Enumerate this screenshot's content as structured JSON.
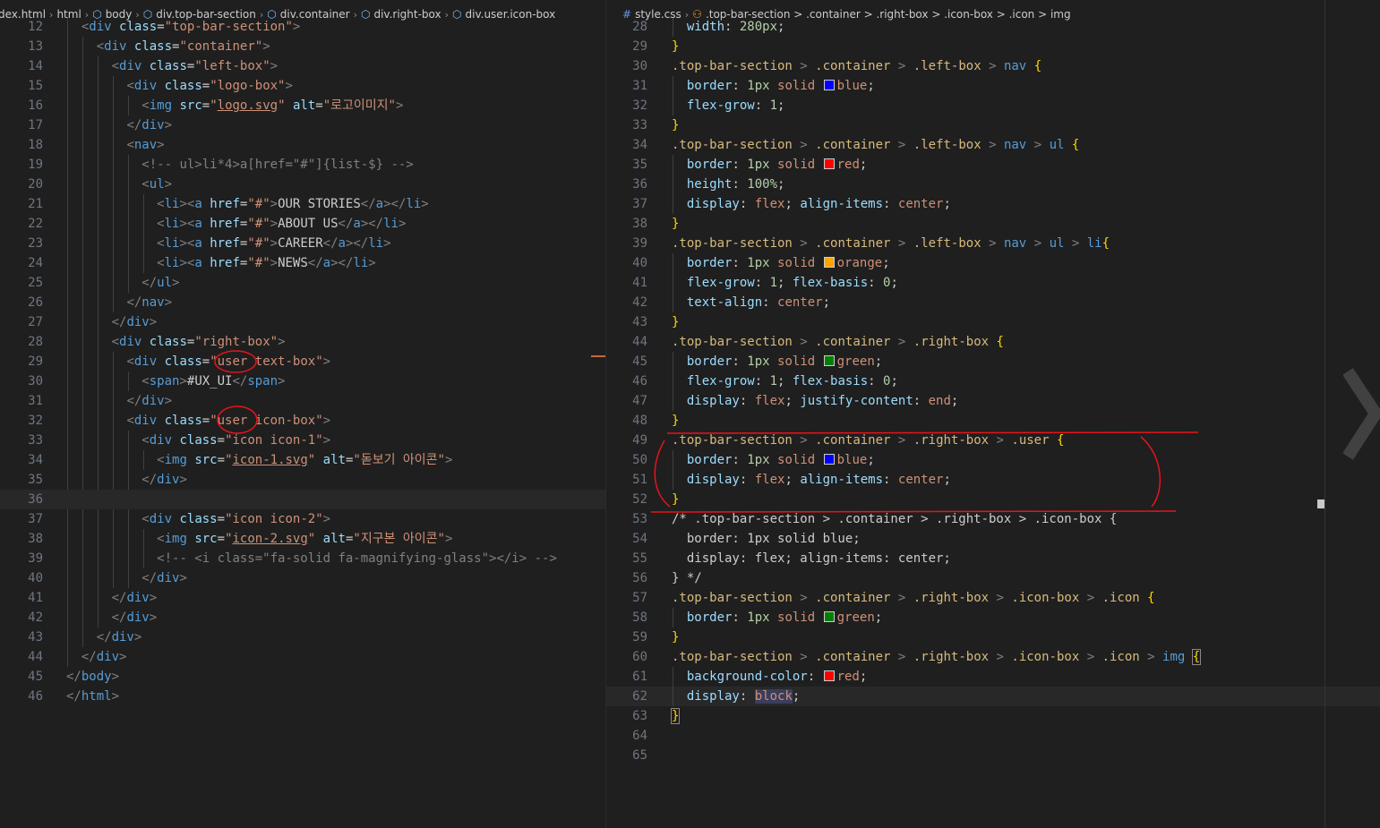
{
  "left_editor": {
    "breadcrumb": [
      "dex.html",
      "html",
      "body",
      "div.top-bar-section",
      "div.container",
      "div.right-box",
      "div.user.icon-box"
    ],
    "lines": [
      {
        "n": "12",
        "html": "  <span class='p'>&lt;</span><span class='t'>div</span> <span class='a'>class</span>=<span class='s'>\"top-bar-section\"</span><span class='p'>&gt;</span>"
      },
      {
        "n": "13",
        "html": "    <span class='p'>&lt;</span><span class='t'>div</span> <span class='a'>class</span>=<span class='s'>\"container\"</span><span class='p'>&gt;</span>"
      },
      {
        "n": "14",
        "html": "      <span class='p'>&lt;</span><span class='t'>div</span> <span class='a'>class</span>=<span class='s'>\"left-box\"</span><span class='p'>&gt;</span>"
      },
      {
        "n": "15",
        "html": "        <span class='p'>&lt;</span><span class='t'>div</span> <span class='a'>class</span>=<span class='s'>\"logo-box\"</span><span class='p'>&gt;</span>"
      },
      {
        "n": "16",
        "html": "          <span class='p'>&lt;</span><span class='t'>img</span> <span class='a'>src</span>=<span class='s'>\"<span class='ul'>logo.svg</span>\"</span> <span class='a'>alt</span>=<span class='s'>\"로고이미지\"</span><span class='p'>&gt;</span>"
      },
      {
        "n": "17",
        "html": "        <span class='p'>&lt;/</span><span class='t'>div</span><span class='p'>&gt;</span>"
      },
      {
        "n": "18",
        "html": "        <span class='p'>&lt;</span><span class='t'>nav</span><span class='p'>&gt;</span>"
      },
      {
        "n": "19",
        "html": "          <span class='p'>&lt;!-- ul&gt;li*4&gt;a[href=\"#\"]{list-$} --&gt;</span>"
      },
      {
        "n": "20",
        "html": "          <span class='p'>&lt;</span><span class='t'>ul</span><span class='p'>&gt;</span>"
      },
      {
        "n": "21",
        "html": "            <span class='p'>&lt;</span><span class='t'>li</span><span class='p'>&gt;&lt;</span><span class='t'>a</span> <span class='a'>href</span>=<span class='s'>\"#\"</span><span class='p'>&gt;</span><span class='plain'>OUR STORIES</span><span class='p'>&lt;/</span><span class='t'>a</span><span class='p'>&gt;&lt;/</span><span class='t'>li</span><span class='p'>&gt;</span>"
      },
      {
        "n": "22",
        "html": "            <span class='p'>&lt;</span><span class='t'>li</span><span class='p'>&gt;&lt;</span><span class='t'>a</span> <span class='a'>href</span>=<span class='s'>\"#\"</span><span class='p'>&gt;</span><span class='plain'>ABOUT US</span><span class='p'>&lt;/</span><span class='t'>a</span><span class='p'>&gt;&lt;/</span><span class='t'>li</span><span class='p'>&gt;</span>"
      },
      {
        "n": "23",
        "html": "            <span class='p'>&lt;</span><span class='t'>li</span><span class='p'>&gt;&lt;</span><span class='t'>a</span> <span class='a'>href</span>=<span class='s'>\"#\"</span><span class='p'>&gt;</span><span class='plain'>CAREER</span><span class='p'>&lt;/</span><span class='t'>a</span><span class='p'>&gt;&lt;/</span><span class='t'>li</span><span class='p'>&gt;</span>"
      },
      {
        "n": "24",
        "html": "            <span class='p'>&lt;</span><span class='t'>li</span><span class='p'>&gt;&lt;</span><span class='t'>a</span> <span class='a'>href</span>=<span class='s'>\"#\"</span><span class='p'>&gt;</span><span class='plain'>NEWS</span><span class='p'>&lt;/</span><span class='t'>a</span><span class='p'>&gt;&lt;/</span><span class='t'>li</span><span class='p'>&gt;</span>"
      },
      {
        "n": "25",
        "html": "          <span class='p'>&lt;/</span><span class='t'>ul</span><span class='p'>&gt;</span>"
      },
      {
        "n": "26",
        "html": "        <span class='p'>&lt;/</span><span class='t'>nav</span><span class='p'>&gt;</span>"
      },
      {
        "n": "27",
        "html": "      <span class='p'>&lt;/</span><span class='t'>div</span><span class='p'>&gt;</span>"
      },
      {
        "n": "28",
        "html": "      <span class='p'>&lt;</span><span class='t'>div</span> <span class='a'>class</span>=<span class='s'>\"right-box\"</span><span class='p'>&gt;</span>"
      },
      {
        "n": "29",
        "html": "        <span class='p'>&lt;</span><span class='t'>div</span> <span class='a'>class</span>=<span class='s'>\"user text-box\"</span><span class='p'>&gt;</span>"
      },
      {
        "n": "30",
        "html": "          <span class='p'>&lt;</span><span class='t'>span</span><span class='p'>&gt;</span><span class='plain'>#UX_UI</span><span class='p'>&lt;/</span><span class='t'>span</span><span class='p'>&gt;</span>"
      },
      {
        "n": "31",
        "html": "        <span class='p'>&lt;/</span><span class='t'>div</span><span class='p'>&gt;</span>"
      },
      {
        "n": "32",
        "html": "        <span class='p'>&lt;</span><span class='t'>div</span> <span class='a'>class</span>=<span class='s'>\"user icon-box\"</span><span class='p'>&gt;</span>"
      },
      {
        "n": "33",
        "html": "          <span class='p'>&lt;</span><span class='t'>div</span> <span class='a'>class</span>=<span class='s'>\"icon icon-1\"</span><span class='p'>&gt;</span>"
      },
      {
        "n": "34",
        "html": "            <span class='p'>&lt;</span><span class='t'>img</span> <span class='a'>src</span>=<span class='s'>\"<span class='ul'>icon-1.svg</span>\"</span> <span class='a'>alt</span>=<span class='s'>\"돋보기 아이콘\"</span><span class='p'>&gt;</span>"
      },
      {
        "n": "35",
        "html": "          <span class='p'>&lt;/</span><span class='t'>div</span><span class='p'>&gt;</span>"
      },
      {
        "n": "36",
        "html": ""
      },
      {
        "n": "37",
        "html": "          <span class='p'>&lt;</span><span class='t'>div</span> <span class='a'>class</span>=<span class='s'>\"icon icon-2\"</span><span class='p'>&gt;</span>"
      },
      {
        "n": "38",
        "html": "            <span class='p'>&lt;</span><span class='t'>img</span> <span class='a'>src</span>=<span class='s'>\"<span class='ul'>icon-2.svg</span>\"</span> <span class='a'>alt</span>=<span class='s'>\"지구본 아이콘\"</span><span class='p'>&gt;</span>"
      },
      {
        "n": "39",
        "html": "            <span class='p'>&lt;!-- &lt;i class=\"fa-solid fa-magnifying-glass\"&gt;&lt;/i&gt; --&gt;</span>"
      },
      {
        "n": "40",
        "html": "          <span class='p'>&lt;/</span><span class='t'>div</span><span class='p'>&gt;</span>"
      },
      {
        "n": "41",
        "html": "      <span class='p'>&lt;/</span><span class='t'>div</span><span class='p'>&gt;</span>"
      },
      {
        "n": "42",
        "html": "      <span class='p'>&lt;/</span><span class='t'>div</span><span class='p'>&gt;</span>"
      },
      {
        "n": "43",
        "html": "    <span class='p'>&lt;/</span><span class='t'>div</span><span class='p'>&gt;</span>"
      },
      {
        "n": "44",
        "html": "  <span class='p'>&lt;/</span><span class='t'>div</span><span class='p'>&gt;</span>"
      },
      {
        "n": "45",
        "html": "<span class='p'>&lt;/</span><span class='t'>body</span><span class='p'>&gt;</span>"
      },
      {
        "n": "46",
        "html": "<span class='p'>&lt;/</span><span class='t'>html</span><span class='p'>&gt;</span>"
      }
    ],
    "current_line": "36"
  },
  "right_editor": {
    "breadcrumb": [
      "style.css",
      ".top-bar-section > .container > .right-box > .icon-box > .icon > img"
    ],
    "lines": [
      {
        "n": "28",
        "html": "  <span class='pr'>width</span>: <span class='n'>280px</span>;"
      },
      {
        "n": "29",
        "html": "<span class='y'>}</span>"
      },
      {
        "n": "30",
        "html": "<span class='sel'>.top-bar-section</span> <span class='p'>&gt;</span> <span class='sel'>.container</span> <span class='p'>&gt;</span> <span class='sel'>.left-box</span> <span class='p'>&gt;</span> <span class='t'>nav</span> <span class='y'>{</span>"
      },
      {
        "n": "31",
        "html": "  <span class='pr'>border</span>: <span class='n'>1px</span> <span class='v'>solid</span> <span class='sw' style='background:#0000ff'></span><span class='v'>blue</span>;"
      },
      {
        "n": "32",
        "html": "  <span class='pr'>flex-grow</span>: <span class='n'>1</span>;"
      },
      {
        "n": "33",
        "html": "<span class='y'>}</span>"
      },
      {
        "n": "34",
        "html": "<span class='sel'>.top-bar-section</span> <span class='p'>&gt;</span> <span class='sel'>.container</span> <span class='p'>&gt;</span> <span class='sel'>.left-box</span> <span class='p'>&gt;</span> <span class='t'>nav</span> <span class='p'>&gt;</span> <span class='t'>ul</span> <span class='y'>{</span>"
      },
      {
        "n": "35",
        "html": "  <span class='pr'>border</span>: <span class='n'>1px</span> <span class='v'>solid</span> <span class='sw' style='background:#ff0000'></span><span class='v'>red</span>;"
      },
      {
        "n": "36",
        "html": "  <span class='pr'>height</span>: <span class='n'>100%</span>;"
      },
      {
        "n": "37",
        "html": "  <span class='pr'>display</span>: <span class='v'>flex</span>; <span class='pr'>align-items</span>: <span class='v'>center</span>;"
      },
      {
        "n": "38",
        "html": "<span class='y'>}</span>"
      },
      {
        "n": "39",
        "html": "<span class='sel'>.top-bar-section</span> <span class='p'>&gt;</span> <span class='sel'>.container</span> <span class='p'>&gt;</span> <span class='sel'>.left-box</span> <span class='p'>&gt;</span> <span class='t'>nav</span> <span class='p'>&gt;</span> <span class='t'>ul</span> <span class='p'>&gt;</span> <span class='t'>li</span><span class='y'>{</span>"
      },
      {
        "n": "40",
        "html": "  <span class='pr'>border</span>: <span class='n'>1px</span> <span class='v'>solid</span> <span class='sw' style='background:#ffa500'></span><span class='v'>orange</span>;"
      },
      {
        "n": "41",
        "html": "  <span class='pr'>flex-grow</span>: <span class='n'>1</span>; <span class='pr'>flex-basis</span>: <span class='n'>0</span>;"
      },
      {
        "n": "42",
        "html": "  <span class='pr'>text-align</span>: <span class='v'>center</span>;"
      },
      {
        "n": "43",
        "html": "<span class='y'>}</span>"
      },
      {
        "n": "44",
        "html": "<span class='sel'>.top-bar-section</span> <span class='p'>&gt;</span> <span class='sel'>.container</span> <span class='p'>&gt;</span> <span class='sel'>.right-box</span> <span class='y'>{</span>"
      },
      {
        "n": "45",
        "html": "  <span class='pr'>border</span>: <span class='n'>1px</span> <span class='v'>solid</span> <span class='sw' style='background:#008000'></span><span class='v'>green</span>;"
      },
      {
        "n": "46",
        "html": "  <span class='pr'>flex-grow</span>: <span class='n'>1</span>; <span class='pr'>flex-basis</span>: <span class='n'>0</span>;"
      },
      {
        "n": "47",
        "html": "  <span class='pr'>display</span>: <span class='v'>flex</span>; <span class='pr'>justify-content</span>: <span class='v'>end</span>;"
      },
      {
        "n": "48",
        "html": "<span class='y'>}</span>"
      },
      {
        "n": "49",
        "html": "<span class='sel'>.top-bar-section</span> <span class='p'>&gt;</span> <span class='sel'>.container</span> <span class='p'>&gt;</span> <span class='sel'>.right-box</span> <span class='p'>&gt;</span> <span class='sel'>.user</span> <span class='y'>{</span>"
      },
      {
        "n": "50",
        "html": "  <span class='pr'>border</span>: <span class='n'>1px</span> <span class='v'>solid</span> <span class='sw' style='background:#0000ff'></span><span class='v'>blue</span>;"
      },
      {
        "n": "51",
        "html": "  <span class='pr'>display</span>: <span class='v'>flex</span>; <span class='pr'>align-items</span>: <span class='v'>center</span>;"
      },
      {
        "n": "52",
        "html": "<span class='y'>}</span>"
      },
      {
        "n": "53",
        "html": "<span class='plain'>/* .top-bar-section &gt; .container &gt; .right-box &gt; .icon-box {</span>"
      },
      {
        "n": "54",
        "html": "<span class='plain'>  border: 1px solid blue;</span>"
      },
      {
        "n": "55",
        "html": "<span class='plain'>  display: flex; align-items: center;</span>"
      },
      {
        "n": "56",
        "html": "<span class='plain'>} */</span>"
      },
      {
        "n": "57",
        "html": "<span class='sel'>.top-bar-section</span> <span class='p'>&gt;</span> <span class='sel'>.container</span> <span class='p'>&gt;</span> <span class='sel'>.right-box</span> <span class='p'>&gt;</span> <span class='sel'>.icon-box</span> <span class='p'>&gt;</span> <span class='sel'>.icon</span> <span class='y'>{</span>"
      },
      {
        "n": "58",
        "html": "  <span class='pr'>border</span>: <span class='n'>1px</span> <span class='v'>solid</span> <span class='sw' style='background:#008000'></span><span class='v'>green</span>;"
      },
      {
        "n": "59",
        "html": "<span class='y'>}</span>"
      },
      {
        "n": "60",
        "html": "<span class='sel'>.top-bar-section</span> <span class='p'>&gt;</span> <span class='sel'>.container</span> <span class='p'>&gt;</span> <span class='sel'>.right-box</span> <span class='p'>&gt;</span> <span class='sel'>.icon-box</span> <span class='p'>&gt;</span> <span class='sel'>.icon</span> <span class='p'>&gt;</span> <span class='t'>img</span> <span class='y bracematch'>{</span>"
      },
      {
        "n": "61",
        "html": "  <span class='pr'>background-color</span>: <span class='sw' style='background:#ff0000'></span><span class='v'>red</span>;"
      },
      {
        "n": "62",
        "html": "  <span class='pr'>display</span>: <span class='v' style='background:#3a3d5c'>block</span>;"
      },
      {
        "n": "63",
        "html": "<span class='y bracematch'>}</span>"
      },
      {
        "n": "64",
        "html": ""
      },
      {
        "n": "65",
        "html": ""
      }
    ],
    "current_line": "62"
  }
}
